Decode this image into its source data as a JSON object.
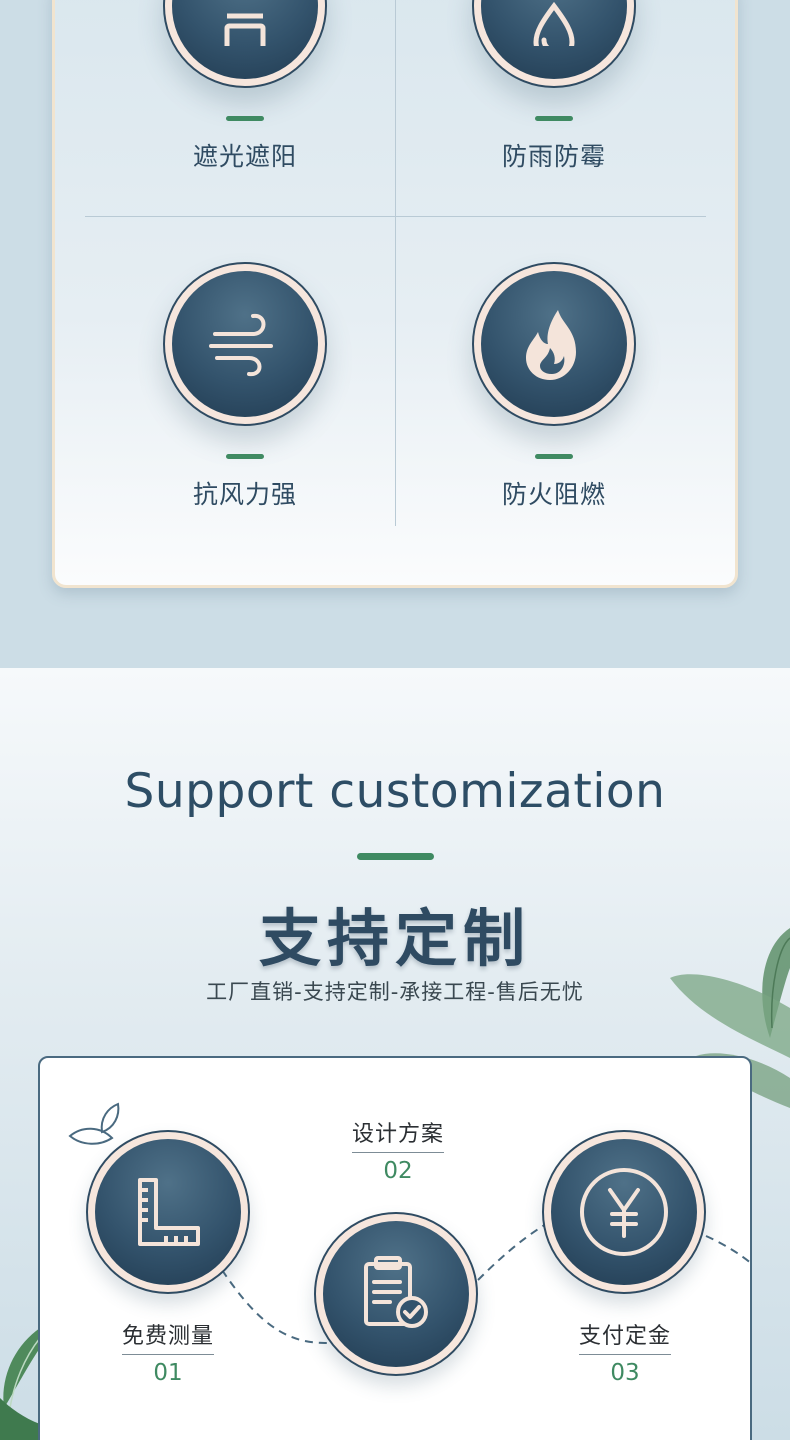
{
  "features": [
    {
      "label": "遮光遮阳",
      "icon": "plant-pot-icon"
    },
    {
      "label": "防雨防霉",
      "icon": "water-drop-icon"
    },
    {
      "label": "抗风力强",
      "icon": "wind-icon"
    },
    {
      "label": "防火阻燃",
      "icon": "flame-icon"
    }
  ],
  "customization": {
    "title_en": "Support customization",
    "title_cn": "支持定制",
    "subtitle": "工厂直销-支持定制-承接工程-售后无忧",
    "steps": [
      {
        "label": "免费测量",
        "number": "01",
        "icon": "ruler-icon"
      },
      {
        "label": "设计方案",
        "number": "02",
        "icon": "clipboard-check-icon"
      },
      {
        "label": "支付定金",
        "number": "03",
        "icon": "yen-icon"
      }
    ]
  },
  "colors": {
    "navy": "#2f4b62",
    "accent_green": "#3f8a62",
    "badge_ring": "#f6e6dd",
    "background": "#ccdde6"
  }
}
